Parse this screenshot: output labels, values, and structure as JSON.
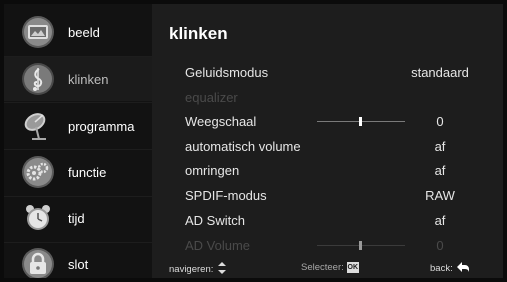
{
  "sidebar": {
    "items": [
      {
        "label": "beeld",
        "icon": "picture-icon"
      },
      {
        "label": "klinken",
        "icon": "music-note-icon"
      },
      {
        "label": "programma",
        "icon": "satellite-dish-icon"
      },
      {
        "label": "functie",
        "icon": "gears-icon"
      },
      {
        "label": "tijd",
        "icon": "alarm-clock-icon"
      },
      {
        "label": "slot",
        "icon": "padlock-icon"
      }
    ],
    "active_index": 1
  },
  "main": {
    "title": "klinken",
    "rows": [
      {
        "name": "Geluidsmodus",
        "value": "standaard",
        "enabled": true
      },
      {
        "name": "equalizer",
        "value": "",
        "enabled": false
      },
      {
        "name": "Weegschaal",
        "value": "0",
        "enabled": true,
        "slider_level": 0.5
      },
      {
        "name": "automatisch volume",
        "value": "af",
        "enabled": true
      },
      {
        "name": "omringen",
        "value": "af",
        "enabled": true
      },
      {
        "name": "SPDIF-modus",
        "value": "RAW",
        "enabled": true
      },
      {
        "name": "AD Switch",
        "value": "af",
        "enabled": true
      },
      {
        "name": "AD Volume",
        "value": "0",
        "enabled": false,
        "slider_level": 0.5
      }
    ]
  },
  "footer": {
    "navigate_label": "navigeren:",
    "select_label": "Selecteer:",
    "ok_label": "OK",
    "back_label": "back:"
  }
}
